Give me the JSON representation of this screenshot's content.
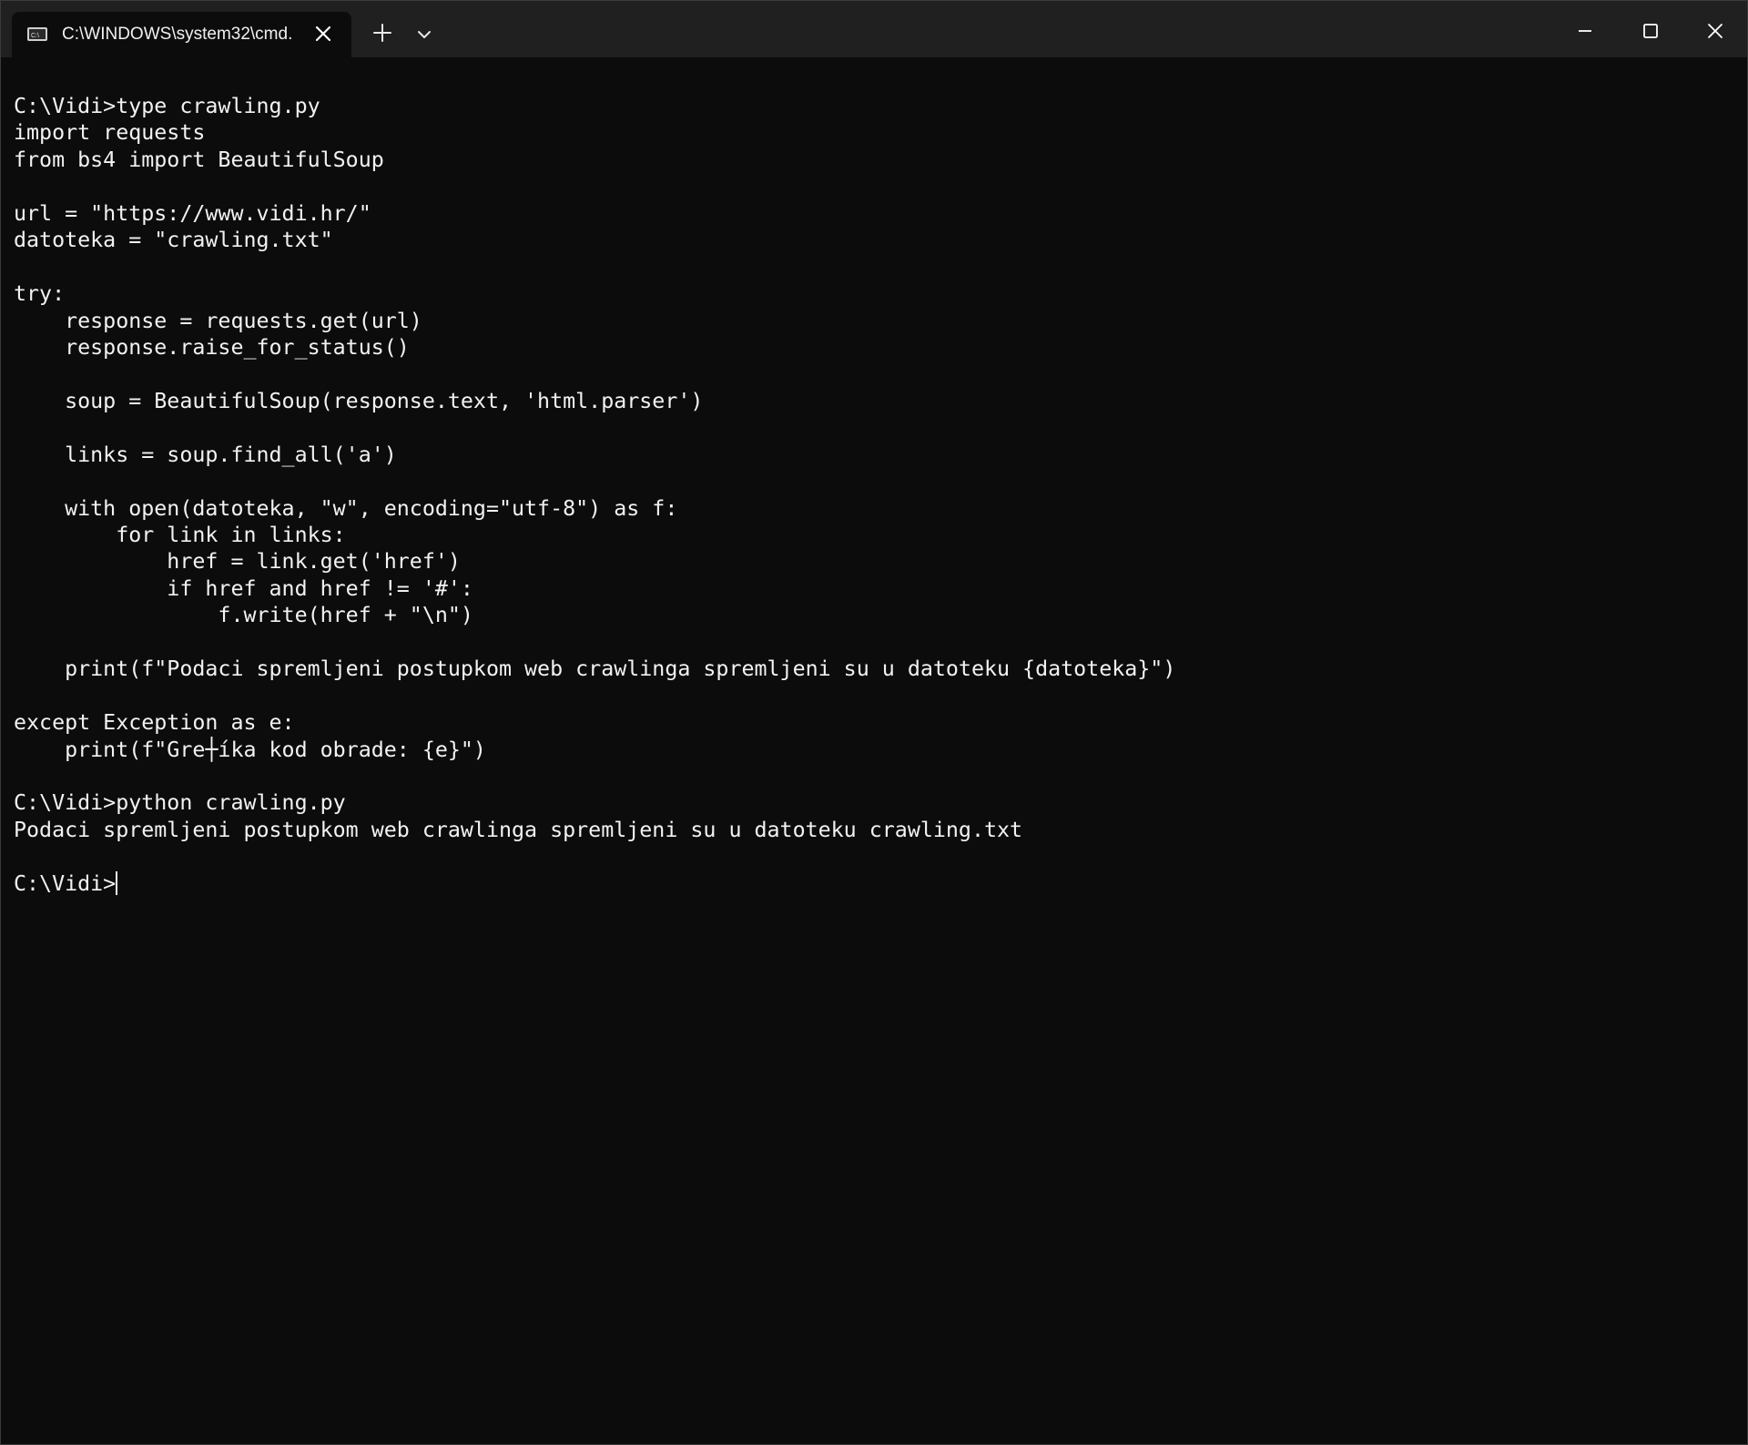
{
  "tab": {
    "title": "C:\\WINDOWS\\system32\\cmd.",
    "icon": "cmd-icon",
    "close_icon": "close-icon"
  },
  "titlebar": {
    "new_tab_icon": "plus-icon",
    "dropdown_icon": "chevron-down-icon",
    "minimize_icon": "minimize-icon",
    "maximize_icon": "maximize-icon",
    "close_icon": "close-icon"
  },
  "console": {
    "lines": [
      "C:\\Vidi>type crawling.py",
      "import requests",
      "from bs4 import BeautifulSoup",
      "",
      "url = \"https://www.vidi.hr/\"",
      "datoteka = \"crawling.txt\"",
      "",
      "try:",
      "    response = requests.get(url)",
      "    response.raise_for_status()",
      "",
      "    soup = BeautifulSoup(response.text, 'html.parser')",
      "",
      "    links = soup.find_all('a')",
      "",
      "    with open(datoteka, \"w\", encoding=\"utf-8\") as f:",
      "        for link in links:",
      "            href = link.get('href')",
      "            if href and href != '#':",
      "                f.write(href + \"\\n\")",
      "",
      "    print(f\"Podaci spremljeni postupkom web crawlinga spremljeni su u datoteku {datoteka}\")",
      "",
      "except Exception as e:",
      "    print(f\"Gre┼íka kod obrade: {e}\")",
      "",
      "C:\\Vidi>python crawling.py",
      "Podaci spremljeni postupkom web crawlinga spremljeni su u datoteku crawling.txt",
      ""
    ],
    "prompt": "C:\\Vidi>"
  },
  "colors": {
    "background": "#0c0c0c",
    "titlebar": "#202020",
    "text": "#f2f2f2"
  }
}
